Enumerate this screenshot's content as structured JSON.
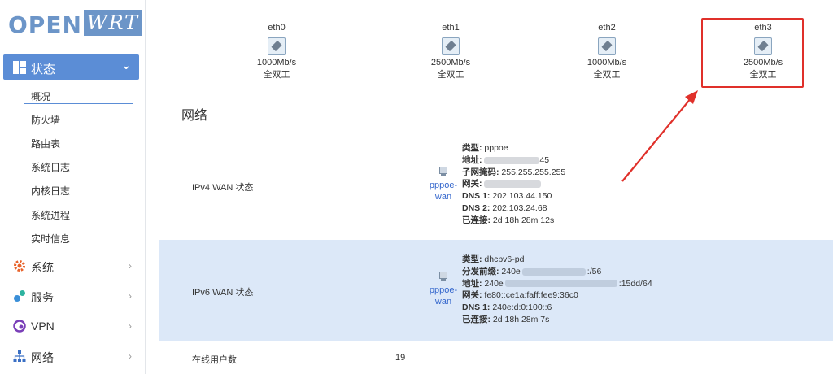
{
  "logo": {
    "left_text": "OPEN",
    "right_text": "WRT"
  },
  "sidebar": {
    "active_section": {
      "label": "状态",
      "icon": "dashboard-icon"
    },
    "sub_items": [
      "概况",
      "防火墙",
      "路由表",
      "系统日志",
      "内核日志",
      "系统进程",
      "实时信息"
    ],
    "active_sub_index": 0,
    "main_items": [
      {
        "label": "系统",
        "icon": "gear-icon",
        "color": "#e8632b"
      },
      {
        "label": "服务",
        "icon": "services-icon",
        "color": "#3a8fd8"
      },
      {
        "label": "VPN",
        "icon": "vpn-icon",
        "color": "#7a3fb8"
      },
      {
        "label": "网络",
        "icon": "network-icon",
        "color": "#3a6fc4"
      }
    ]
  },
  "ports": [
    {
      "name": "eth0",
      "speed": "1000Mb/s",
      "duplex": "全双工"
    },
    {
      "name": "eth1",
      "speed": "2500Mb/s",
      "duplex": "全双工"
    },
    {
      "name": "eth2",
      "speed": "1000Mb/s",
      "duplex": "全双工"
    },
    {
      "name": "eth3",
      "speed": "2500Mb/s",
      "duplex": "全双工"
    }
  ],
  "highlighted_port": "eth3",
  "network": {
    "title": "网络",
    "ipv4": {
      "label": "IPv4 WAN 状态",
      "iface_line1": "pppoe-",
      "iface_line2": "wan",
      "rows": [
        {
          "key": "类型:",
          "val": " pppoe"
        },
        {
          "key": "地址:",
          "val": "",
          "tail": "45"
        },
        {
          "key": "子网掩码:",
          "val": " 255.255.255.255"
        },
        {
          "key": "网关:",
          "val": ""
        },
        {
          "key": "DNS 1:",
          "val": " 202.103.44.150"
        },
        {
          "key": "DNS 2:",
          "val": " 202.103.24.68"
        },
        {
          "key": "已连接:",
          "val": " 2d 18h 28m 12s"
        }
      ]
    },
    "ipv6": {
      "label": "IPv6 WAN 状态",
      "iface_line1": "pppoe-",
      "iface_line2": "wan",
      "rows": [
        {
          "key": "类型:",
          "val": " dhcpv6-pd"
        },
        {
          "key": "分发前缀:",
          "val": " 240e",
          "tail": ":/56"
        },
        {
          "key": "地址:",
          "val": " 240e",
          "tail": ":15dd/64"
        },
        {
          "key": "网关:",
          "val": " fe80::ce1a:faff:fee9:36c0"
        },
        {
          "key": "DNS 1:",
          "val": " 240e:d:0:100::6"
        },
        {
          "key": "已连接:",
          "val": " 2d 18h 28m 7s"
        }
      ]
    },
    "online_users": {
      "label": "在线用户数",
      "value": "19"
    }
  },
  "colors": {
    "accent": "#5b8dd6",
    "highlight": "#e0302a",
    "row_bg": "#dce8f8"
  }
}
